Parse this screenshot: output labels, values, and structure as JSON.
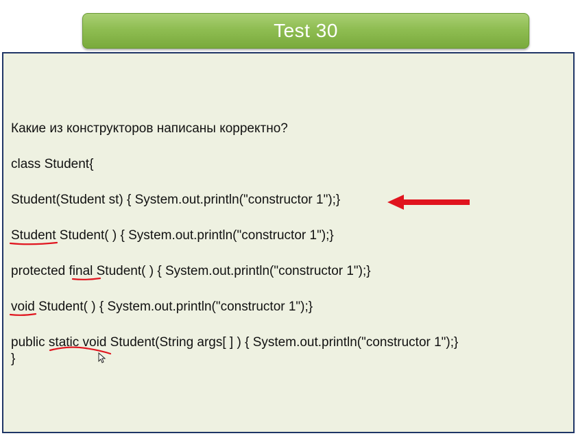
{
  "title": "Test 30",
  "lines": {
    "question": "Какие из конструкторов написаны корректно?",
    "class_decl": "class Student{",
    "option1": "Student(Student st) { System.out.println(\"constructor 1\");}",
    "option2": "Student Student( ) { System.out.println(\"constructor 1\");}",
    "option3": "protected final Student( ) { System.out.println(\"constructor 1\");}",
    "option4": "void Student( ) { System.out.println(\"constructor 1\");}",
    "option5": "public static void Student(String args[ ] ) { System.out.println(\"constructor 1\");}",
    "closing": "}"
  },
  "colors": {
    "title_bar": "#8fbd52",
    "content_bg": "#eef1e1",
    "content_border": "#1f3566",
    "annotation": "#e0141e"
  },
  "icons": {
    "arrow": "red-left-arrow-icon",
    "cursor": "mouse-pointer-icon"
  }
}
